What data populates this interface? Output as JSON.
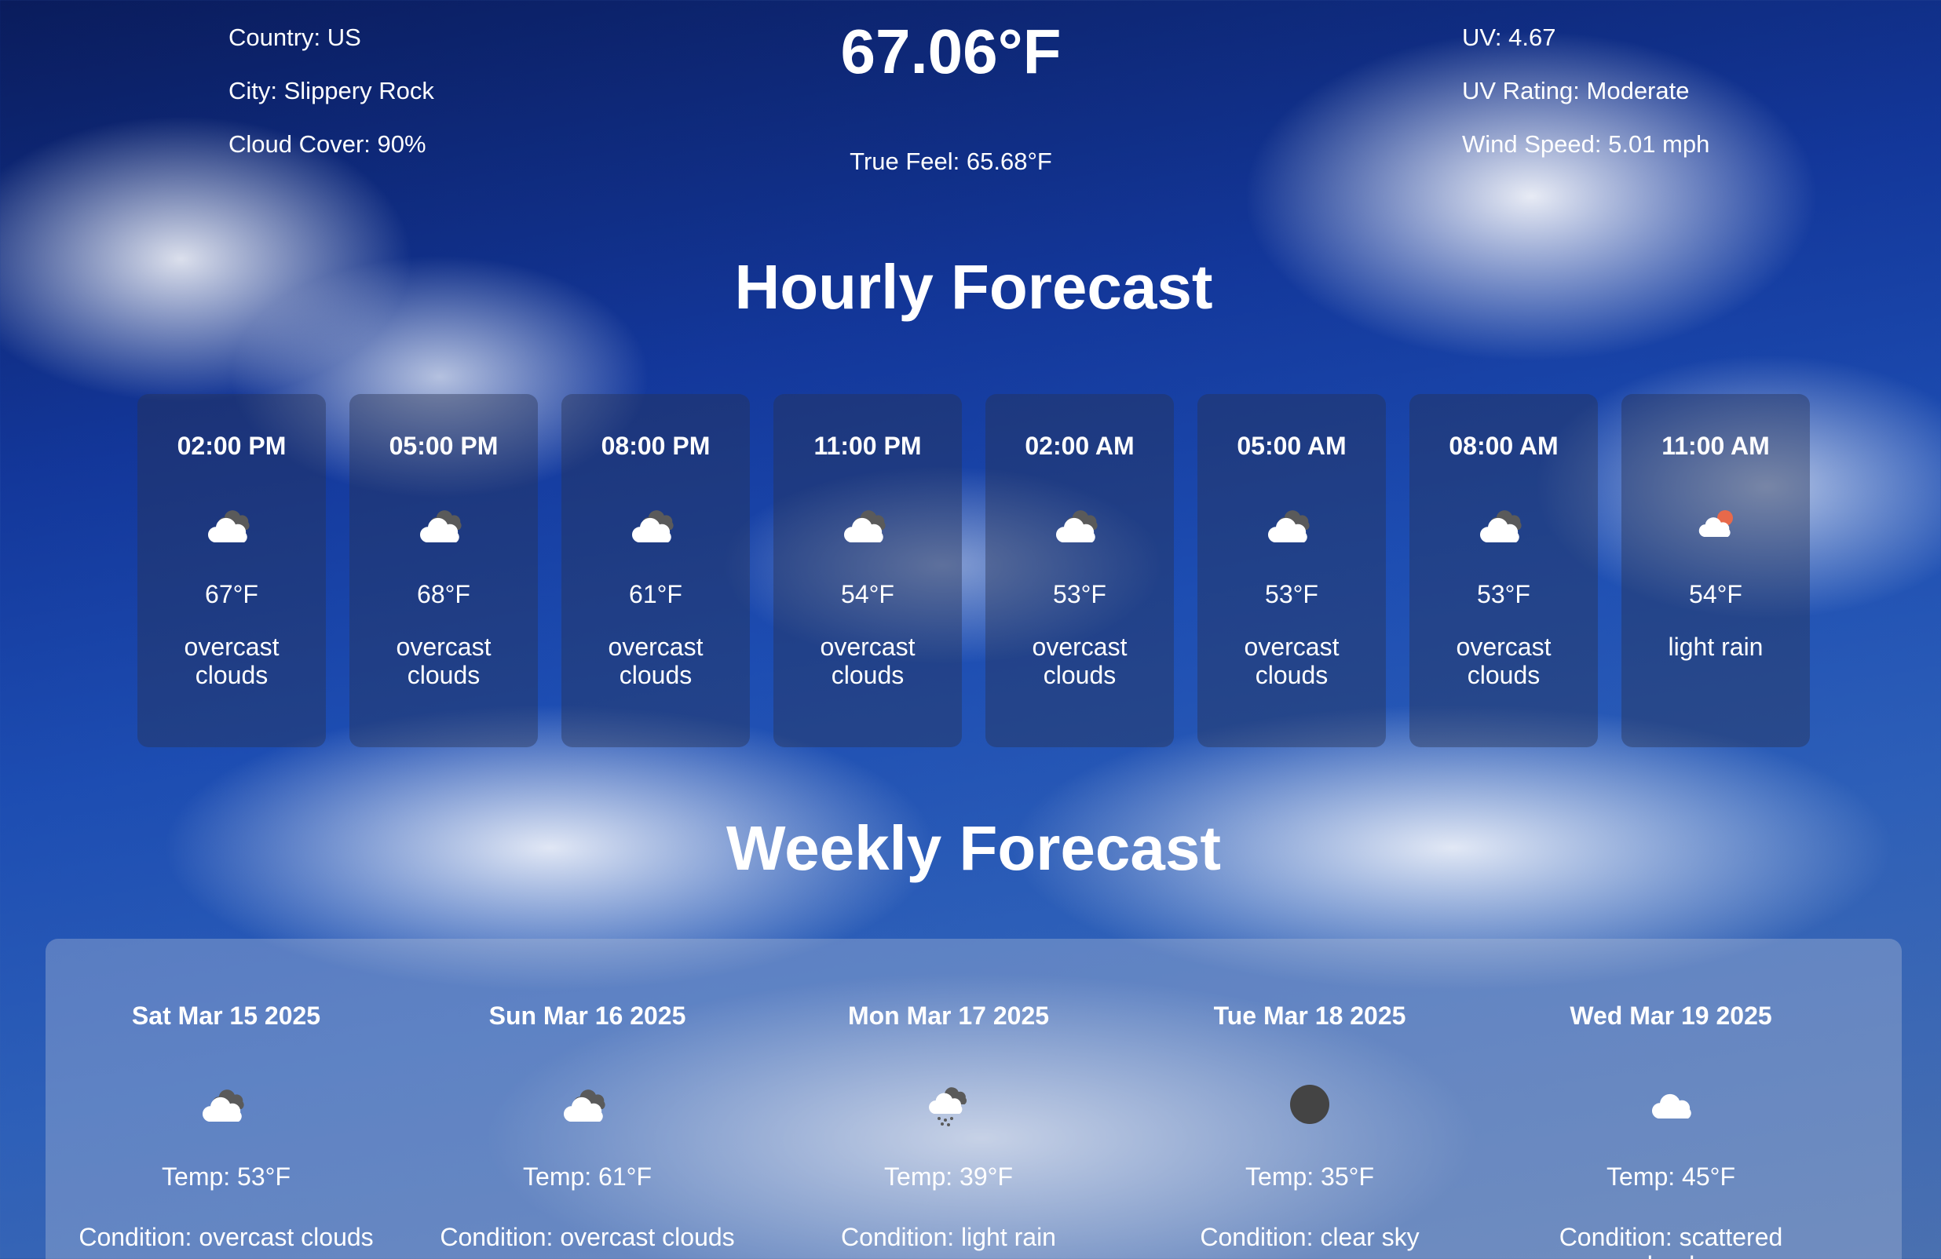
{
  "location": {
    "country": "Country: US",
    "city": "City: Slippery Rock",
    "cloud_cover": "Cloud Cover: 90%"
  },
  "current": {
    "temp": "67.06°F",
    "true_feel": "True Feel: 65.68°F"
  },
  "conditions": {
    "uv": "UV: 4.67",
    "uv_rating": "UV Rating: Moderate",
    "wind_speed": "Wind Speed: 5.01 mph"
  },
  "hourly": {
    "title": "Hourly Forecast",
    "items": [
      {
        "time": "02:00 PM",
        "temp": "67°F",
        "desc": "overcast clouds",
        "icon": "overcast-clouds-icon"
      },
      {
        "time": "05:00 PM",
        "temp": "68°F",
        "desc": "overcast clouds",
        "icon": "overcast-clouds-icon"
      },
      {
        "time": "08:00 PM",
        "temp": "61°F",
        "desc": "overcast clouds",
        "icon": "overcast-clouds-icon"
      },
      {
        "time": "11:00 PM",
        "temp": "54°F",
        "desc": "overcast clouds",
        "icon": "overcast-clouds-icon"
      },
      {
        "time": "02:00 AM",
        "temp": "53°F",
        "desc": "overcast clouds",
        "icon": "overcast-clouds-icon"
      },
      {
        "time": "05:00 AM",
        "temp": "53°F",
        "desc": "overcast clouds",
        "icon": "overcast-clouds-icon"
      },
      {
        "time": "08:00 AM",
        "temp": "53°F",
        "desc": "overcast clouds",
        "icon": "overcast-clouds-icon"
      },
      {
        "time": "11:00 AM",
        "temp": "54°F",
        "desc": "light rain",
        "icon": "light-rain-sun-icon"
      }
    ]
  },
  "weekly": {
    "title": "Weekly Forecast",
    "items": [
      {
        "date": "Sat Mar 15 2025",
        "temp": "Temp: 53°F",
        "condition": "Condition: overcast clouds",
        "icon": "overcast-clouds-icon"
      },
      {
        "date": "Sun Mar 16 2025",
        "temp": "Temp: 61°F",
        "condition": "Condition: overcast clouds",
        "icon": "overcast-clouds-icon"
      },
      {
        "date": "Mon Mar 17 2025",
        "temp": "Temp: 39°F",
        "condition": "Condition: light rain",
        "icon": "rain-cloud-icon"
      },
      {
        "date": "Tue Mar 18 2025",
        "temp": "Temp: 35°F",
        "condition": "Condition: clear sky",
        "icon": "clear-night-icon"
      },
      {
        "date": "Wed Mar 19 2025",
        "temp": "Temp: 45°F",
        "condition": "Condition: scattered clouds",
        "icon": "cloud-icon"
      }
    ]
  },
  "colors": {
    "icon_cloud": "#ffffff",
    "icon_dark_cloud": "#5a5a5a",
    "icon_sun": "#e8694a",
    "icon_moon": "#444444"
  }
}
